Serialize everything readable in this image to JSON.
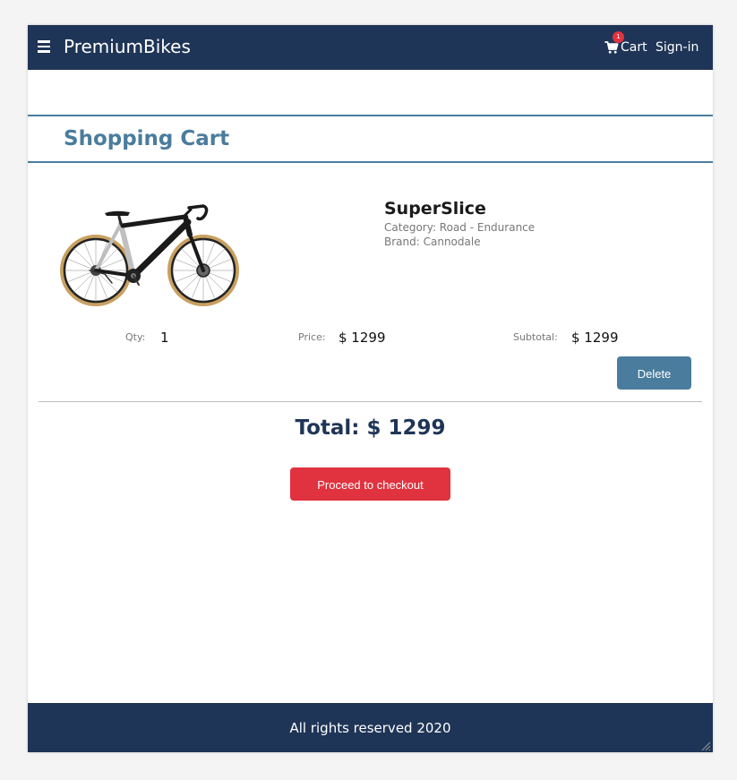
{
  "header": {
    "brand": "PremiumBikes",
    "cart_label": "Cart",
    "cart_count": "1",
    "signin_label": "Sign-in",
    "icons": [
      "menu-icon",
      "cart-icon"
    ]
  },
  "page": {
    "title": "Shopping Cart"
  },
  "cart": {
    "items": [
      {
        "name": "SuperSlice",
        "category": "Category: Road - Endurance",
        "brand": "Brand: Cannodale",
        "qty_label": "Qty:",
        "qty": "1",
        "price_label": "Price:",
        "price": "$ 1299",
        "subtotal_label": "Subtotal:",
        "subtotal": "$ 1299",
        "delete_label": "Delete"
      }
    ],
    "total": "Total: $ 1299",
    "checkout_label": "Proceed to checkout"
  },
  "footer": {
    "text": "All rights reserved 2020"
  },
  "colors": {
    "navbar": "#1f3557",
    "accent": "#4a7c9d",
    "checkout": "#e0333f",
    "badge": "#e0333f"
  }
}
